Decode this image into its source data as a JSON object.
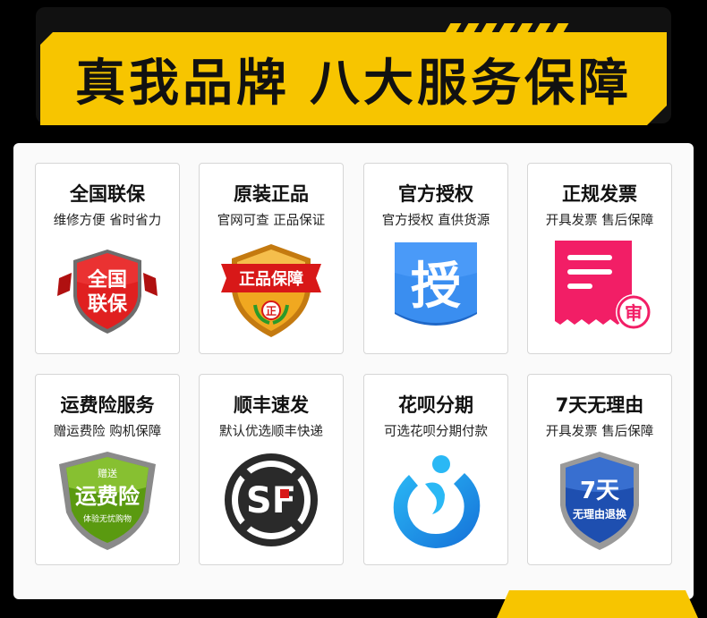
{
  "banner": {
    "title_part1": "真我品牌",
    "title_part2": "八大服务保障"
  },
  "cards": [
    {
      "title": "全国联保",
      "subtitle": "维修方便 省时省力",
      "icon": "nationwide-warranty-badge-icon",
      "badge_line1": "全国",
      "badge_line2": "联保"
    },
    {
      "title": "原装正品",
      "subtitle": "官网可查 正品保证",
      "icon": "genuine-product-badge-icon",
      "badge_text": "正品保障",
      "badge_seal": "正"
    },
    {
      "title": "官方授权",
      "subtitle": "官方授权 直供货源",
      "icon": "official-authorization-icon",
      "badge_text": "授"
    },
    {
      "title": "正规发票",
      "subtitle": "开具发票 售后保障",
      "icon": "invoice-icon",
      "badge_text": "审"
    },
    {
      "title": "运费险服务",
      "subtitle": "赠运费险 购机保障",
      "icon": "shipping-insurance-badge-icon",
      "badge_top": "赠送",
      "badge_main": "运费险",
      "badge_bottom": "体验无忧购物"
    },
    {
      "title": "顺丰速发",
      "subtitle": "默认优选顺丰快递",
      "icon": "sf-express-logo-icon",
      "badge_text": "SF"
    },
    {
      "title": "花呗分期",
      "subtitle": "可选花呗分期付款",
      "icon": "huabei-logo-icon"
    },
    {
      "title": "7天无理由",
      "subtitle": "开具发票 售后保障",
      "icon": "seven-day-return-shield-icon",
      "badge_main": "7天",
      "badge_sub": "无理由退换"
    }
  ],
  "colors": {
    "accent_yellow": "#f7c500",
    "red_badge": "#d91a1a",
    "gold_badge": "#e8a318",
    "blue_auth": "#2e7fe0",
    "pink_invoice": "#f0206a",
    "green_badge": "#6ab018",
    "blue_shield": "#1d5bbf",
    "cyan_huabei": "#1aa3e8"
  }
}
